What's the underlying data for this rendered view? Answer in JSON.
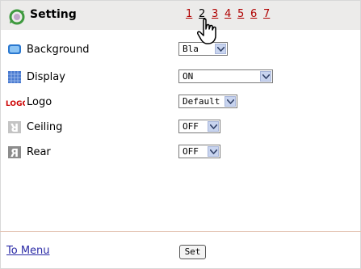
{
  "header": {
    "title": "Setting",
    "icon": "recycle-settings-icon",
    "pages": [
      {
        "label": "1",
        "current": false
      },
      {
        "label": "2",
        "current": true
      },
      {
        "label": "3",
        "current": false
      },
      {
        "label": "4",
        "current": false
      },
      {
        "label": "5",
        "current": false
      },
      {
        "label": "6",
        "current": false
      },
      {
        "label": "7",
        "current": false
      }
    ]
  },
  "rows": [
    {
      "label": "Background",
      "icon": "monitor-icon",
      "value": "Bla",
      "icon_color": "#3a8ad8"
    },
    {
      "label": "Display",
      "icon": "display-grid-icon",
      "value": "ON",
      "icon_color": "#4a7ad0"
    },
    {
      "label": "Logo",
      "icon": "logo-badge-icon",
      "icon_text": "LOGO",
      "value": "Default",
      "icon_color": "#cc0000"
    },
    {
      "label": "Ceiling",
      "icon": "ceiling-flip-icon",
      "icon_text": "R",
      "value": "OFF",
      "icon_color": "#b8b8b8"
    },
    {
      "label": "Rear",
      "icon": "rear-flip-icon",
      "icon_text": "R",
      "value": "OFF",
      "icon_color": "#888888"
    }
  ],
  "footer": {
    "menu_link": "To Menu",
    "set_button": "Set"
  },
  "colors": {
    "header_bg": "#ecebea",
    "page_link": "#b00000",
    "menu_link": "#2a2aa6",
    "divider": "#e4c4b4"
  },
  "cursor": "hand-pointer-icon"
}
